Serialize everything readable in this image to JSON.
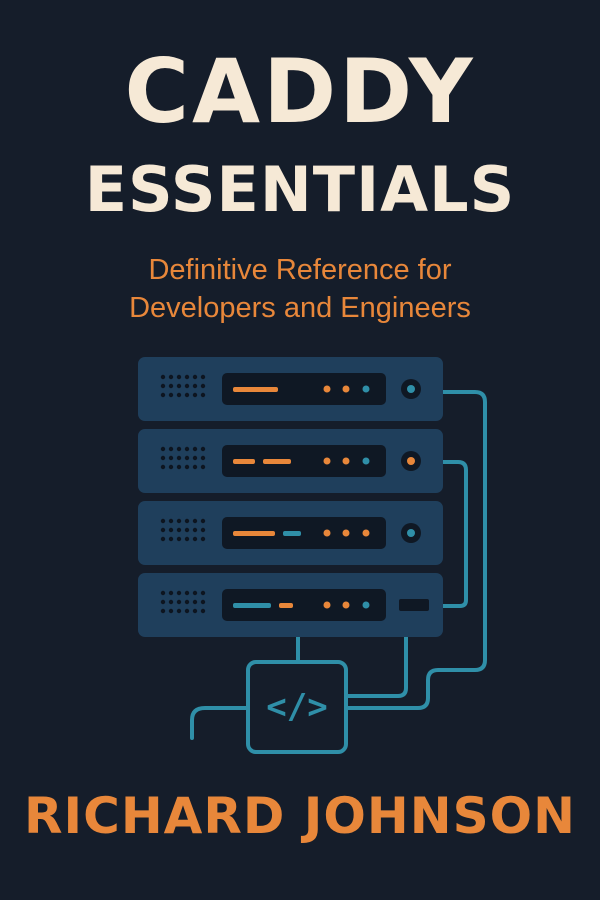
{
  "cover": {
    "title_line_1": "CADDY",
    "title_line_2": "ESSENTIALS",
    "subtitle_line_1": "Definitive Reference for",
    "subtitle_line_2": "Developers and Engineers",
    "author": "RICHARD JOHNSON",
    "code_symbol": "</>"
  },
  "illustration": {
    "icon": "server-rack-with-code-icon",
    "server_unit_count": 4
  },
  "colors": {
    "background": "#151d2a",
    "title": "#f6e9d6",
    "accent_orange": "#e8873a",
    "server_body": "#1f3f5c",
    "server_panel": "#0f1824",
    "cable_teal": "#2f8fa8"
  }
}
